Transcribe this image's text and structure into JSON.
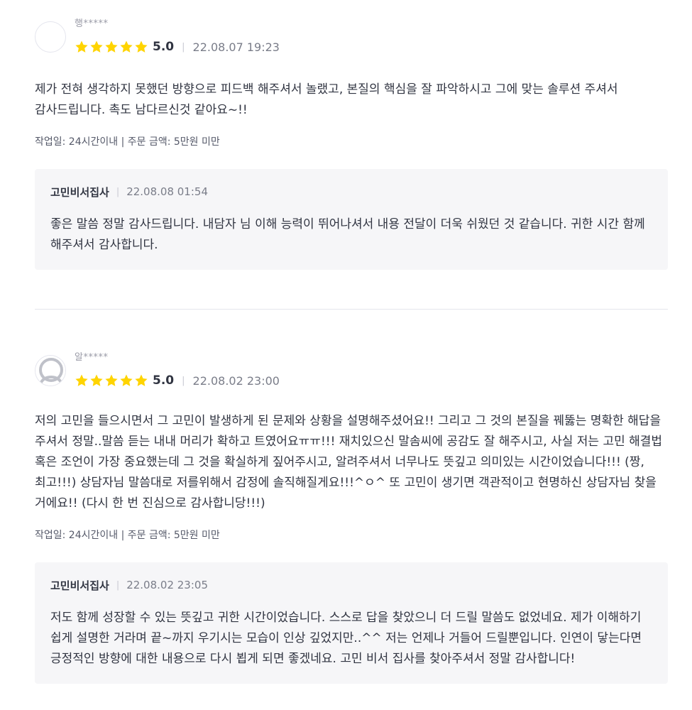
{
  "reviews": [
    {
      "nickname": "행*****",
      "rating": "5.0",
      "stars": 5,
      "date": "22.08.07 19:23",
      "content": "제가 전혀 생각하지 못했던 방향으로 피드백 해주셔서 놀랬고, 본질의 핵심을 잘 파악하시고 그에 맞는 솔루션 주셔서 감사드립니다. 촉도 남다르신것 같아요~!!",
      "work_info": "작업일: 24시간이내 | 주문 금액: 5만원 미만",
      "reply": {
        "seller": "고민비서집사",
        "date": "22.08.08 01:54",
        "content": "좋은 말씀 정말 감사드립니다. 내담자 님 이해 능력이 뛰어나셔서 내용 전달이 더욱 쉬웠던 것 같습니다. 귀한 시간 함께 해주셔서 감사합니다."
      }
    },
    {
      "nickname": "알*****",
      "rating": "5.0",
      "stars": 5,
      "date": "22.08.02 23:00",
      "content": "저의 고민을 들으시면서 그 고민이 발생하게 된 문제와 상황을 설명해주셨어요!! 그리고 그 것의 본질을 꿰뚫는 명확한 해답을 주셔서 정말..말씀 듣는 내내 머리가 확하고 트였어요ㅠㅠ!!! 재치있으신 말솜씨에 공감도 잘 해주시고, 사실 저는 고민 해결법 혹은 조언이 가장 중요했는데 그 것을 확실하게 짚어주시고, 알려주셔서 너무나도 뜻깊고 의미있는 시간이었습니다!!! (짱, 최고!!!) 상담자님 말씀대로 저를위해서 감정에 솔직해질게요!!!^ㅇ^ 또 고민이 생기면 객관적이고 현명하신 상담자님 찾을 거에요!! (다시 한 번 진심으로 감사합니당!!!)",
      "work_info": "작업일: 24시간이내 | 주문 금액: 5만원 미만",
      "reply": {
        "seller": "고민비서집사",
        "date": "22.08.02 23:05",
        "content": "저도 함께 성장할 수 있는 뜻깊고 귀한 시간이었습니다. 스스로 답을 찾았으니 더 드릴 말씀도 없었네요. 제가 이해하기 쉽게 설명한 거라며 끝~까지 우기시는 모습이 인상 깊었지만..^^ 저는 언제나 거들어 드릴뿐입니다. 인연이 닿는다면 긍정적인 방향에 대한 내용으로 다시 뵙게 되면 좋겠네요. 고민 비서 집사를 찾아주셔서 정말 감사합니다!"
      }
    }
  ],
  "colors": {
    "star": "#FFD400",
    "text": "#303441",
    "muted": "#7a7d89",
    "reply_bg": "#f6f6f8",
    "divider": "#e4e5ed"
  },
  "icons": {
    "avatar_1": "blank-avatar-icon",
    "avatar_2": "default-user-avatar-icon",
    "star": "star-icon"
  }
}
